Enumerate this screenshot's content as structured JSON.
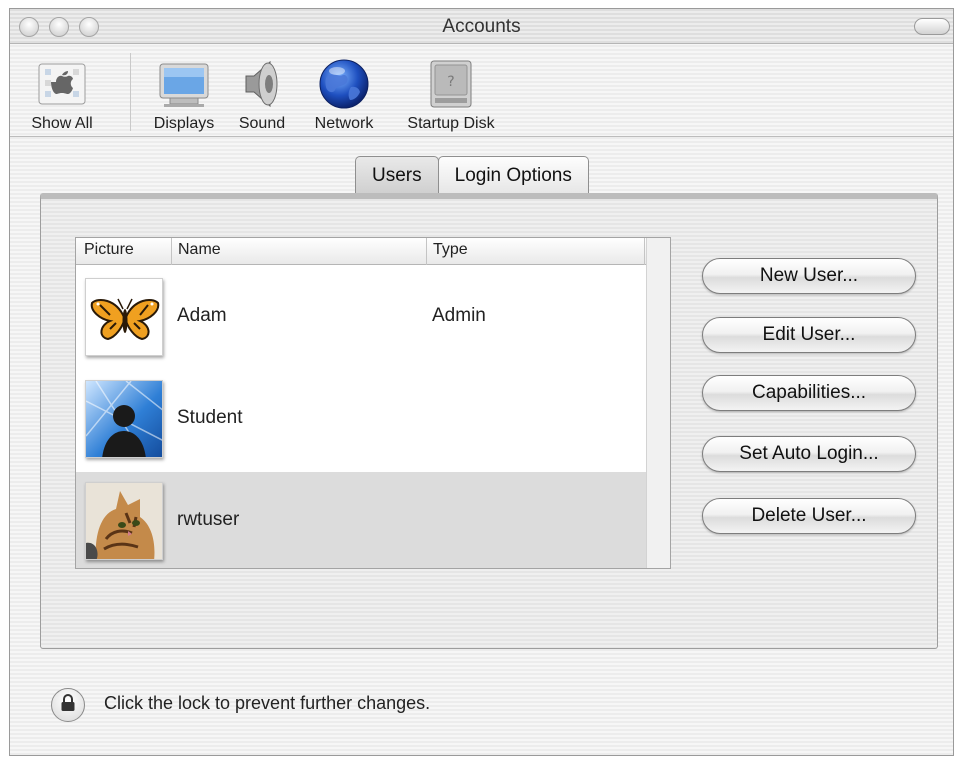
{
  "window": {
    "title": "Accounts"
  },
  "toolbar": {
    "items": [
      {
        "label": "Show All",
        "icon": "apple-show-all-icon"
      },
      {
        "label": "Displays",
        "icon": "display-icon"
      },
      {
        "label": "Sound",
        "icon": "speaker-icon"
      },
      {
        "label": "Network",
        "icon": "globe-icon"
      },
      {
        "label": "Startup Disk",
        "icon": "hard-disk-icon"
      }
    ]
  },
  "tabs": [
    {
      "label": "Users",
      "active": true
    },
    {
      "label": "Login Options",
      "active": false
    }
  ],
  "users_table": {
    "columns": [
      "Picture",
      "Name",
      "Type"
    ],
    "rows": [
      {
        "picture": "butterfly",
        "name": "Adam",
        "type": "Admin",
        "selected": false
      },
      {
        "picture": "silhouette",
        "name": "Student",
        "type": "",
        "selected": false
      },
      {
        "picture": "cat",
        "name": "rwtuser",
        "type": "",
        "selected": true
      }
    ]
  },
  "buttons": {
    "new_user": "New User...",
    "edit_user": "Edit User...",
    "capabilities": "Capabilities...",
    "set_auto_login": "Set Auto Login...",
    "delete_user": "Delete User..."
  },
  "lock": {
    "icon": "lock-icon",
    "text": "Click the lock to prevent further changes."
  },
  "colors": {
    "selected_row": "#dcdcdc",
    "butterfly_orange": "#f0a020",
    "aqua_blue": "#2f7fd6"
  }
}
